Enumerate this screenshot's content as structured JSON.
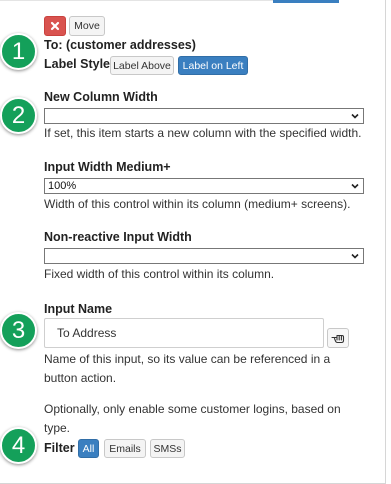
{
  "header": {
    "delete_icon": "close-icon",
    "move_label": "Move",
    "title": "To: (customer addresses)"
  },
  "steps": [
    "1",
    "2",
    "3",
    "4"
  ],
  "label_style": {
    "label": "Label Style",
    "options": [
      "Label Above",
      "Label on Left"
    ],
    "selected": "Label on Left"
  },
  "new_column_width": {
    "label": "New Column Width",
    "value": "",
    "help": "If set, this item starts a new column with the specified width."
  },
  "input_width_medium": {
    "label": "Input Width Medium+",
    "value": "100%",
    "help": "Width of this control within its column (medium+ screens)."
  },
  "non_reactive_width": {
    "label": "Non-reactive Input Width",
    "value": "",
    "help": "Fixed width of this control within its column."
  },
  "input_name": {
    "label": "Input Name",
    "value": "To Address",
    "icon": "hand-pointer-icon",
    "help": "Name of this input, so its value can be referenced in a button action."
  },
  "filter": {
    "intro": "Optionally, only enable some customer logins, based on type.",
    "label": "Filter",
    "options": [
      "All",
      "Emails",
      "SMSs"
    ],
    "selected": "All"
  },
  "colors": {
    "accent": "#3a7fc0",
    "step_badge": "#14a05a",
    "danger": "#d9534f"
  }
}
